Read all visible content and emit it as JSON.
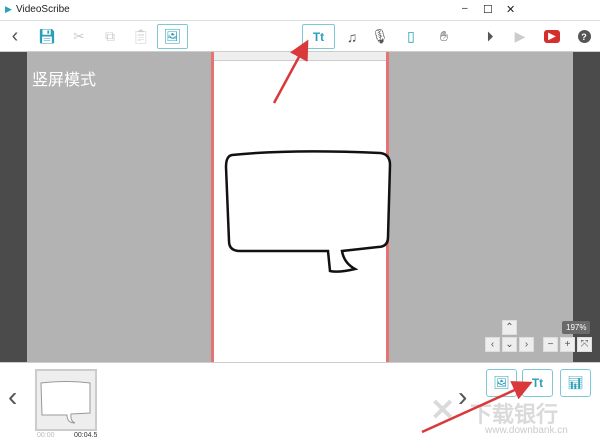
{
  "window": {
    "title": "VideoScribe",
    "minimize": "–",
    "maximize": "☐",
    "close": "✕"
  },
  "toolbar": {
    "back": "‹",
    "text_button": "Tt",
    "help": "?"
  },
  "canvas": {
    "mode_label": "竖屏模式",
    "zoom": "197%"
  },
  "timeline": {
    "start_time": "00:00",
    "end_time": "00:04.5",
    "text_button": "Tt"
  },
  "watermark": {
    "brand": "下载银行",
    "url": "www.downbank.cn"
  },
  "colors": {
    "accent": "#2aa0b8",
    "arrow": "#d9393a",
    "page_border": "#e57373"
  }
}
